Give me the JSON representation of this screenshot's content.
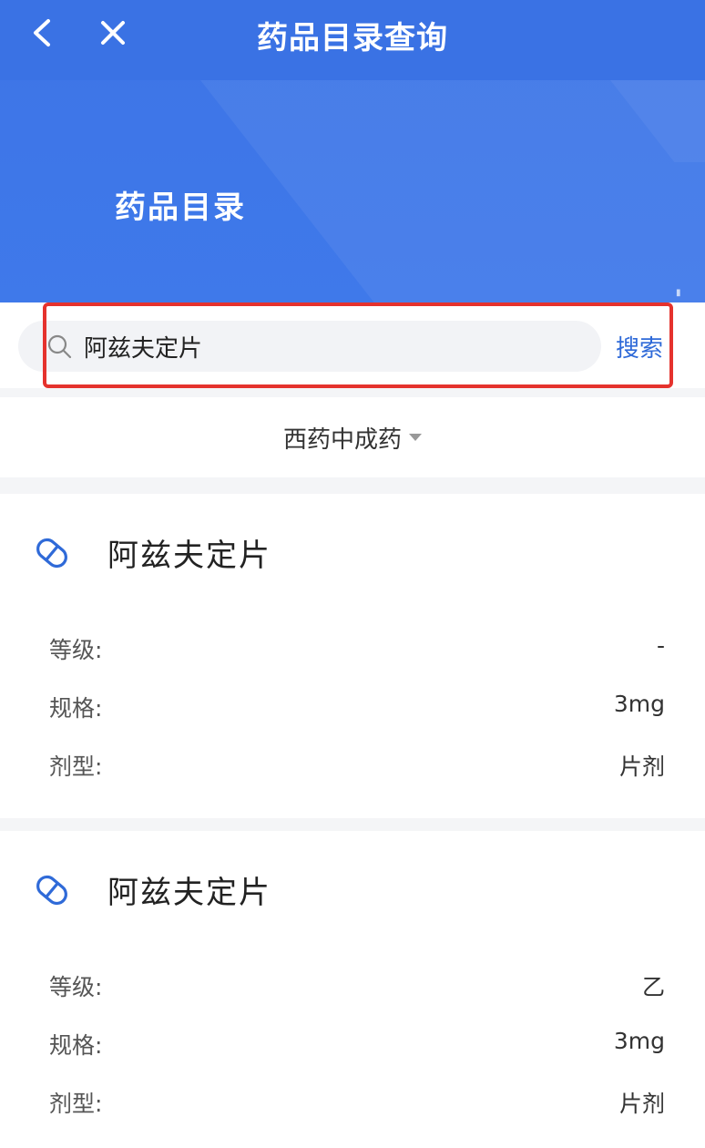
{
  "nav": {
    "title": "药品目录查询"
  },
  "banner": {
    "title": "药品目录"
  },
  "search": {
    "value": "阿兹夫定片",
    "button_label": "搜索"
  },
  "filter": {
    "selected": "西药中成药"
  },
  "results": [
    {
      "name": "阿兹夫定片",
      "fields": [
        {
          "label": "等级:",
          "value": "-"
        },
        {
          "label": "规格:",
          "value": "3mg"
        },
        {
          "label": "剂型:",
          "value": "片剂"
        }
      ]
    },
    {
      "name": "阿兹夫定片",
      "fields": [
        {
          "label": "等级:",
          "value": "乙"
        },
        {
          "label": "规格:",
          "value": "3mg"
        },
        {
          "label": "剂型:",
          "value": "片剂"
        }
      ]
    }
  ],
  "colors": {
    "header_blue": "#3d74e6",
    "accent_blue": "#2f6ad8",
    "highlight_red": "#e5322d"
  },
  "icons": {
    "back": "chevron-left-icon",
    "close": "close-icon",
    "search": "search-icon",
    "drug": "pill-icon",
    "filter_caret": "caret-down-icon"
  }
}
